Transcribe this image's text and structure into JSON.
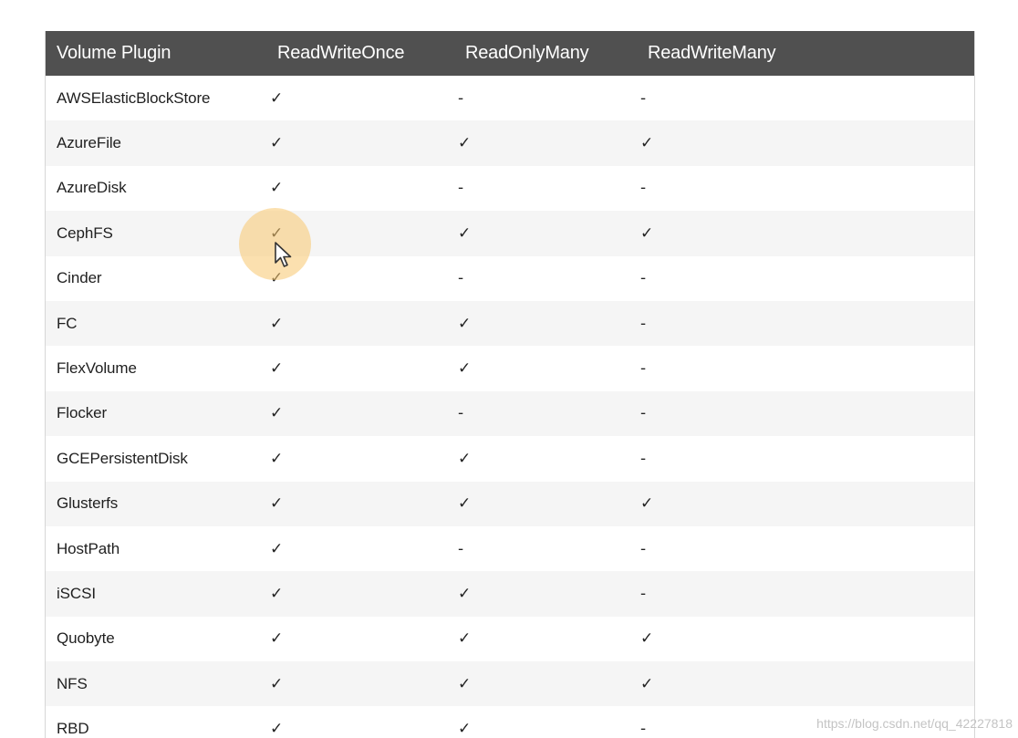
{
  "table": {
    "headers": [
      "Volume Plugin",
      "ReadWriteOnce",
      "ReadOnlyMany",
      "ReadWriteMany"
    ],
    "rows": [
      [
        "AWSElasticBlockStore",
        "✓",
        "-",
        "-"
      ],
      [
        "AzureFile",
        "✓",
        "✓",
        "✓"
      ],
      [
        "AzureDisk",
        "✓",
        "-",
        "-"
      ],
      [
        "CephFS",
        "✓",
        "✓",
        "✓"
      ],
      [
        "Cinder",
        "✓",
        "-",
        "-"
      ],
      [
        "FC",
        "✓",
        "✓",
        "-"
      ],
      [
        "FlexVolume",
        "✓",
        "✓",
        "-"
      ],
      [
        "Flocker",
        "✓",
        "-",
        "-"
      ],
      [
        "GCEPersistentDisk",
        "✓",
        "✓",
        "-"
      ],
      [
        "Glusterfs",
        "✓",
        "✓",
        "✓"
      ],
      [
        "HostPath",
        "✓",
        "-",
        "-"
      ],
      [
        "iSCSI",
        "✓",
        "✓",
        "-"
      ],
      [
        "Quobyte",
        "✓",
        "✓",
        "✓"
      ],
      [
        "NFS",
        "✓",
        "✓",
        "✓"
      ],
      [
        "RBD",
        "✓",
        "✓",
        "-"
      ]
    ]
  },
  "watermark": "https://blog.csdn.net/qq_42227818",
  "colors": {
    "header_bg": "#505050",
    "stripe_bg": "#f5f5f5",
    "cursor_highlight": "#f7c66e"
  },
  "icons": {
    "cursor": "mouse-pointer-icon"
  }
}
